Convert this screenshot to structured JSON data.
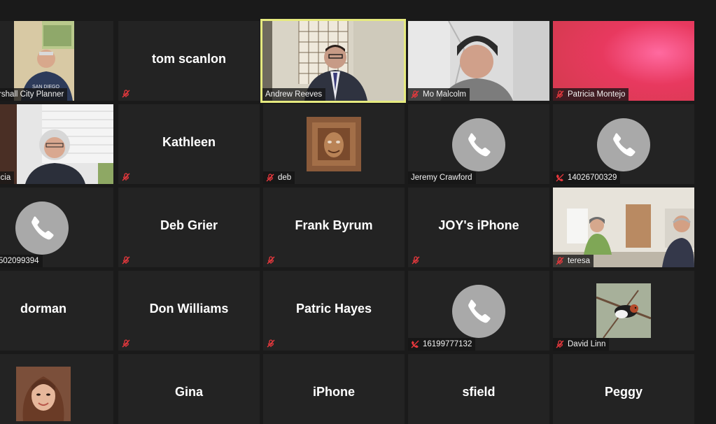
{
  "participants": [
    {
      "name": "rshall City Planner",
      "type": "video",
      "muted": true
    },
    {
      "name": "tom scanlon",
      "type": "name",
      "muted": true
    },
    {
      "name": "Andrew Reeves",
      "type": "video",
      "muted": false,
      "active_speaker": true
    },
    {
      "name": "Mo Malcolm",
      "type": "video",
      "muted": true
    },
    {
      "name": "Patricia Montejo",
      "type": "video",
      "muted": true
    },
    {
      "name": "icia",
      "type": "video",
      "muted": false
    },
    {
      "name": "Kathleen",
      "type": "name",
      "muted": true
    },
    {
      "name": "deb",
      "type": "thumb",
      "muted": true
    },
    {
      "name": "Jeremy Crawford",
      "type": "phone",
      "muted": false
    },
    {
      "name": "14026700329",
      "type": "phone",
      "muted": true
    },
    {
      "name": "502099394",
      "type": "phone",
      "muted": false
    },
    {
      "name": "Deb Grier",
      "type": "name",
      "muted": true
    },
    {
      "name": "Frank Byrum",
      "type": "name",
      "muted": true
    },
    {
      "name": "JOY's iPhone",
      "type": "name",
      "muted": true
    },
    {
      "name": "teresa",
      "type": "video",
      "muted": true
    },
    {
      "name": "dorman",
      "type": "name",
      "muted": false
    },
    {
      "name": "Don Williams",
      "type": "name",
      "muted": true
    },
    {
      "name": "Patric Hayes",
      "type": "name",
      "muted": true
    },
    {
      "name": "16199777132",
      "type": "phone",
      "muted": true
    },
    {
      "name": "David Linn",
      "type": "thumb",
      "muted": true
    },
    {
      "name": "",
      "type": "thumb",
      "muted": false
    },
    {
      "name": "Gina",
      "type": "name",
      "muted": true
    },
    {
      "name": "iPhone",
      "type": "name",
      "muted": true
    },
    {
      "name": "sfield",
      "type": "name",
      "muted": true
    },
    {
      "name": "Peggy",
      "type": "name",
      "muted": true
    }
  ],
  "colors": {
    "background": "#1a1a1a",
    "tile": "#232323",
    "active_border": "#e6ea7f",
    "mute_red": "#e8383d",
    "phone_circle": "#a9a9a9"
  }
}
